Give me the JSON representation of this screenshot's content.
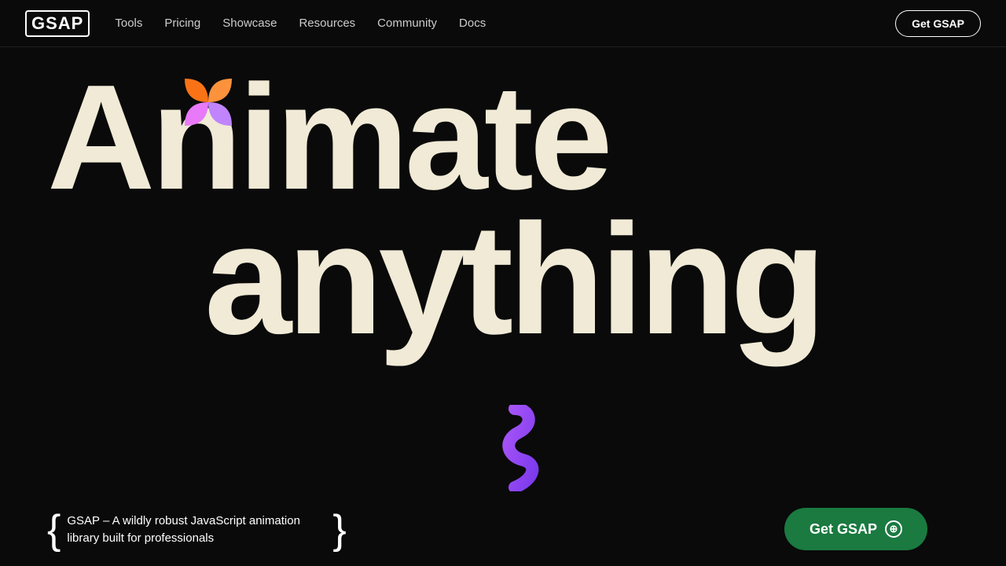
{
  "brand": {
    "logo": "GSAP"
  },
  "navbar": {
    "links": [
      {
        "label": "Tools",
        "id": "tools"
      },
      {
        "label": "Pricing",
        "id": "pricing"
      },
      {
        "label": "Showcase",
        "id": "showcase"
      },
      {
        "label": "Resources",
        "id": "resources"
      },
      {
        "label": "Community",
        "id": "community"
      },
      {
        "label": "Docs",
        "id": "docs"
      }
    ],
    "cta": "Get GSAP"
  },
  "hero": {
    "line1": "Animate",
    "line2": "anything",
    "description": "GSAP – A wildly robust JavaScript animation library built for professionals",
    "cta_button": "Get GSAP",
    "cta_icon": "⊕"
  },
  "colors": {
    "background": "#0a0a0a",
    "text_primary": "#f0ead6",
    "nav_text": "#cccccc",
    "cta_green": "#1a7a40"
  }
}
